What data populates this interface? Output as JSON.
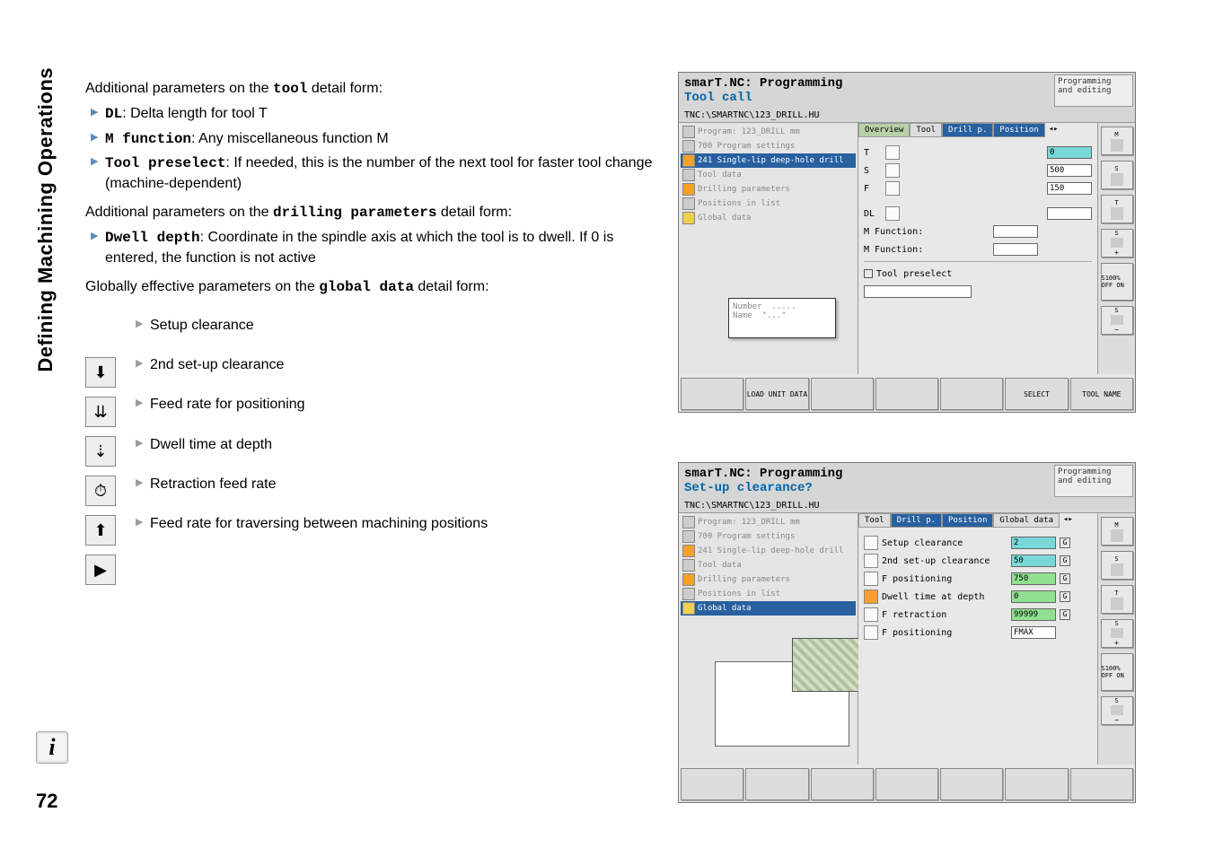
{
  "header": {
    "vertical": "Defining Machining Operations",
    "page": "72"
  },
  "body": {
    "p1": "Additional parameters on the ",
    "p1b": "tool",
    "p1c": " detail form:",
    "b1a": "DL",
    "b1b": ": Delta length for tool T",
    "b2a": "M function",
    "b2b": ": Any miscellaneous function M",
    "b3a": "Tool preselect",
    "b3b": ": If needed, this is the number of the next tool for faster tool change (machine-dependent)",
    "p2a": "Additional parameters on the ",
    "p2b": "drilling parameters",
    "p2c": " detail form:",
    "b4a": "Dwell depth",
    "b4b": ": Coordinate in the spindle axis at which the tool is to dwell. If 0 is entered, the function is not active",
    "p3a": "Globally effective parameters on the ",
    "p3b": "global data",
    "p3c": " detail form:",
    "g1": "Setup clearance",
    "g2": "2nd set-up clearance",
    "g3": "Feed rate for positioning",
    "g4": "Dwell time at depth",
    "g5": "Retraction feed rate",
    "g6": "Feed rate for traversing between machining positions"
  },
  "shot1": {
    "title1": "smarT.NC: Programming",
    "title2": "Tool call",
    "status": "Programming and editing",
    "path": "TNC:\\SMARTNC\\123_DRILL.HU",
    "tabs": [
      "Overview",
      "Tool",
      "Drill p.",
      "Position"
    ],
    "tree": [
      "Program: 123_DRILL mm",
      "700 Program settings",
      "241 Single-lip deep-hole drill",
      "Tool data",
      "Drilling parameters",
      "Positions in list",
      "Global data"
    ],
    "form": {
      "T": "T",
      "T_val": "0",
      "S": "S",
      "S_val": "500",
      "F": "F",
      "F_val": "150",
      "DL": "DL",
      "MF1": "M Function:",
      "MF2": "M Function:",
      "preselect": "Tool preselect"
    },
    "helper": {
      "number": "Number",
      "name": "Name",
      "dots": ".....",
      "quotes": "\"...\""
    },
    "bottom": [
      "",
      "LOAD UNIT DATA",
      "",
      "",
      "",
      "SELECT",
      "TOOL NAME"
    ],
    "side": [
      "M",
      "S",
      "T",
      "S",
      "S100% OFF ON",
      "S"
    ]
  },
  "shot2": {
    "title1": "smarT.NC: Programming",
    "title2": "Set-up clearance?",
    "status": "Programming and editing",
    "path": "TNC:\\SMARTNC\\123_DRILL.HU",
    "tabs": [
      "Tool",
      "Drill p.",
      "Position",
      "Global data"
    ],
    "tree": [
      "Program: 123_DRILL mm",
      "700 Program settings",
      "241 Single-lip deep-hole drill",
      "Tool data",
      "Drilling parameters",
      "Positions in list",
      "Global data"
    ],
    "form": [
      {
        "icon": true,
        "label": "Setup clearance",
        "val": "2",
        "cls": "highlight",
        "g": true
      },
      {
        "icon": true,
        "label": "2nd set-up clearance",
        "val": "50",
        "cls": "highlight",
        "g": true
      },
      {
        "icon": true,
        "label": "F positioning",
        "val": "750",
        "cls": "green",
        "g": true
      },
      {
        "icon": true,
        "orange": true,
        "label": "Dwell time at depth",
        "val": "0",
        "cls": "green",
        "g": true
      },
      {
        "icon": true,
        "label": "F retraction",
        "val": "99999",
        "cls": "green",
        "g": true
      },
      {
        "icon": true,
        "label": "F positioning",
        "val": "FMAX",
        "g": false
      }
    ],
    "side": [
      "M",
      "S",
      "T",
      "S",
      "S100% OFF ON",
      "S"
    ]
  }
}
